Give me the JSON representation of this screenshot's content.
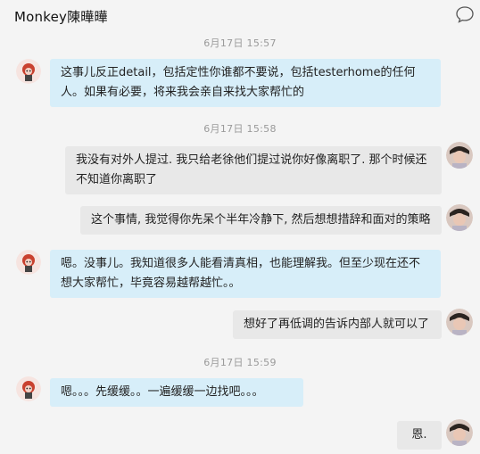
{
  "header": {
    "title": "Monkey陳曄曄",
    "compose_icon": "chat-bubble-icon"
  },
  "messages": [
    {
      "type": "time",
      "text": "6月17日  15:57"
    },
    {
      "type": "incoming",
      "avatar": "monkey-avatar",
      "text": "这事儿反正detail，包括定性你谁都不要说，包括testerhome的任何人。如果有必要，将来我会亲自来找大家帮忙的"
    },
    {
      "type": "time",
      "text": "6月17日  15:58"
    },
    {
      "type": "outgoing",
      "avatar": "user-avatar",
      "text": "我没有对外人提过. 我只给老徐他们提过说你好像离职了. 那个时候还不知道你离职了"
    },
    {
      "type": "outgoing",
      "avatar": "user-avatar",
      "text": "这个事情, 我觉得你先呆个半年冷静下, 然后想想措辞和面对的策略"
    },
    {
      "type": "incoming",
      "avatar": "monkey-avatar",
      "text": "嗯。没事儿。我知道很多人能看清真相，也能理解我。但至少现在还不想大家帮忙，毕竟容易越帮越忙。。"
    },
    {
      "type": "outgoing",
      "avatar": "user-avatar",
      "text": "想好了再低调的告诉内部人就可以了"
    },
    {
      "type": "time",
      "text": "6月17日  15:59"
    },
    {
      "type": "incoming",
      "avatar": "monkey-avatar",
      "text": "嗯。。。先缓缓。。一遍缓缓一边找吧。。。"
    },
    {
      "type": "outgoing",
      "avatar": "user-avatar",
      "text": "恩."
    }
  ],
  "colors": {
    "incoming_bubble": "#d7eef9",
    "outgoing_bubble": "#e8e8e8",
    "background": "#f4f4f4"
  }
}
